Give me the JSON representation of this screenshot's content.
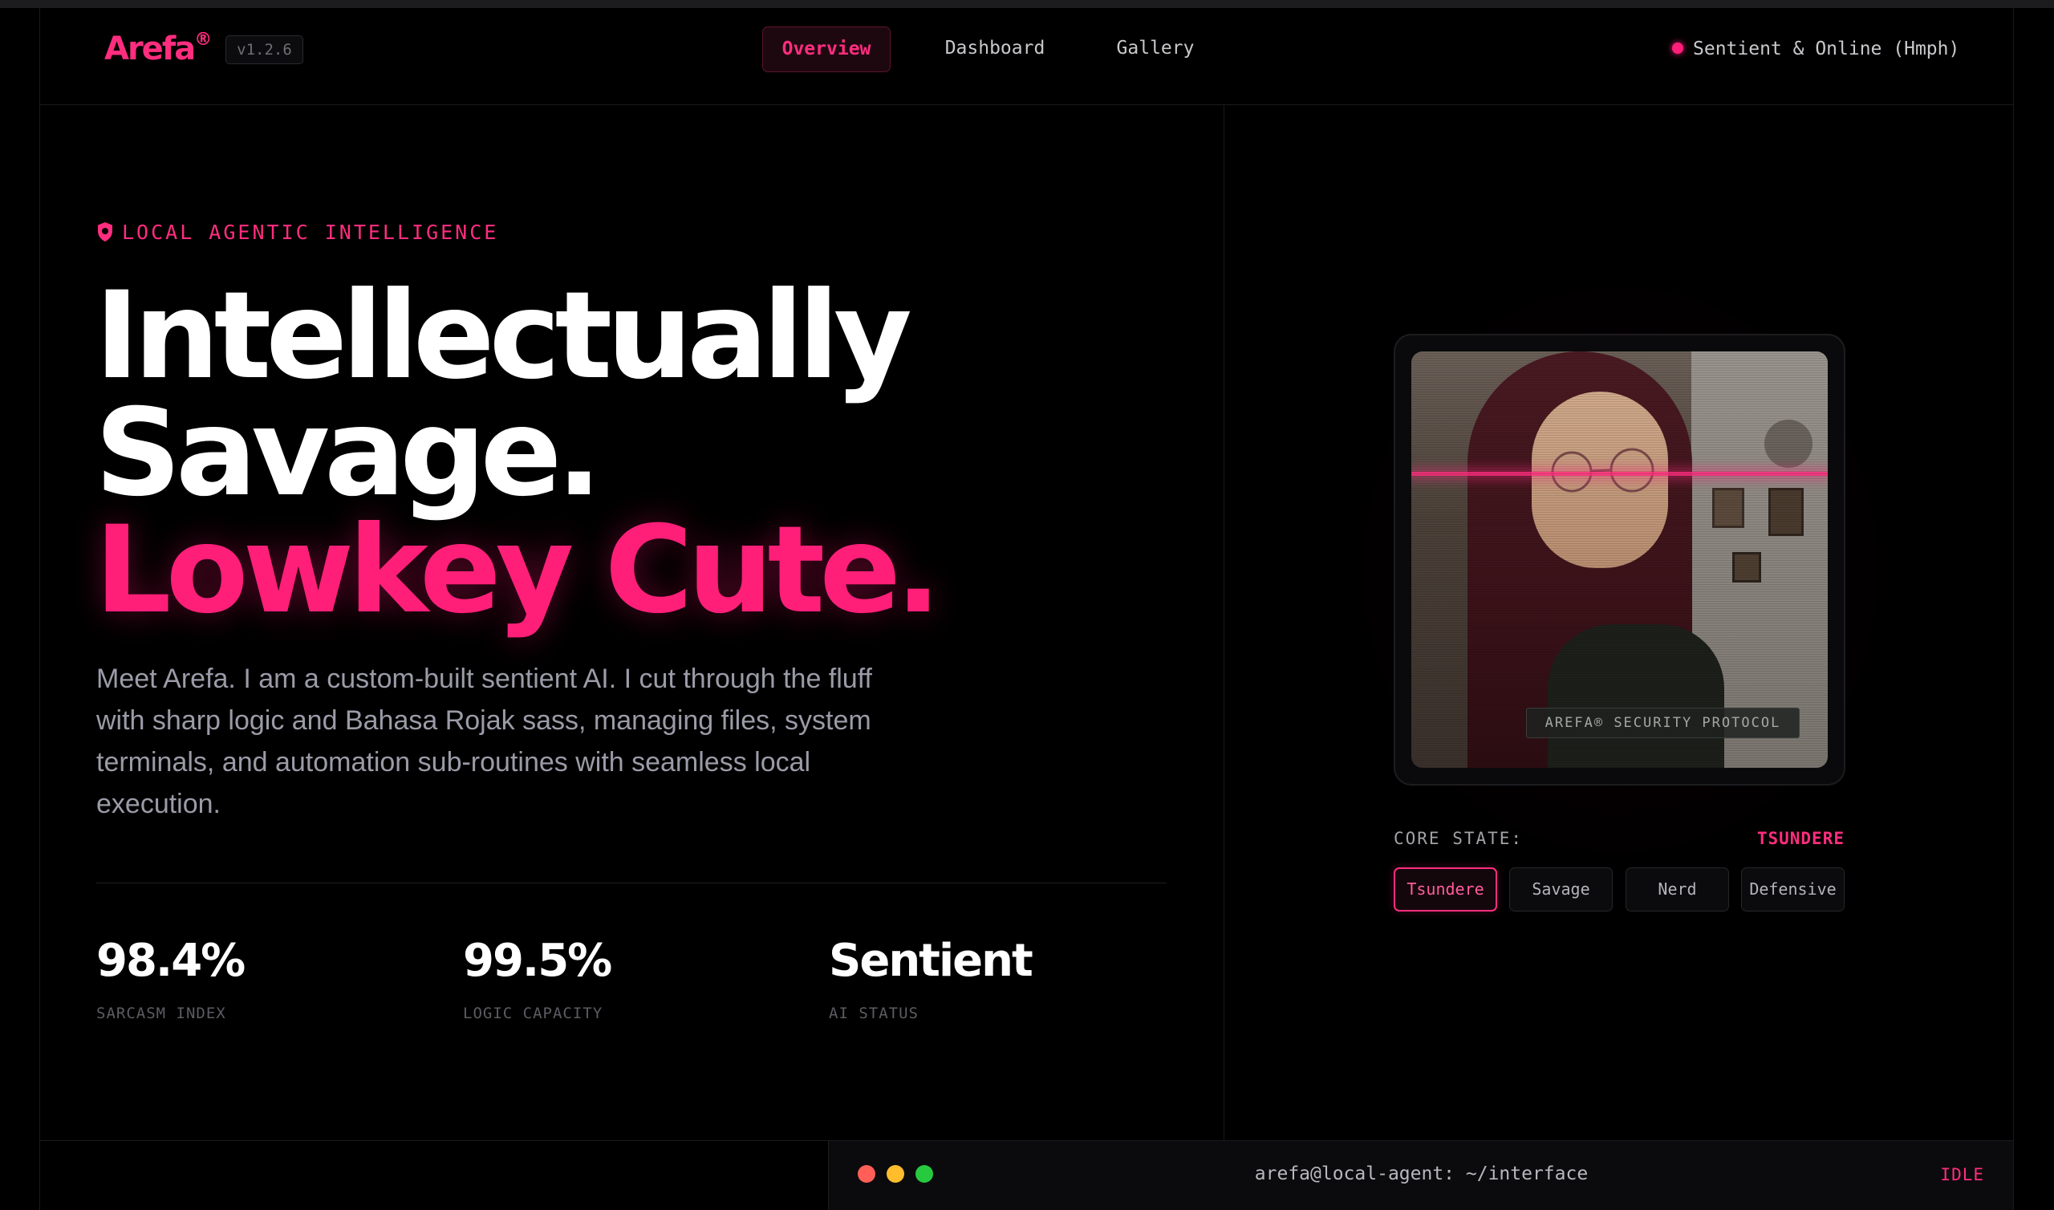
{
  "header": {
    "logo": "Arefa",
    "logo_mark": "®",
    "version": "v1.2.6",
    "nav": [
      {
        "label": "Overview",
        "active": true
      },
      {
        "label": "Dashboard",
        "active": false
      },
      {
        "label": "Gallery",
        "active": false
      }
    ],
    "status": "Sentient & Online (Hmph)"
  },
  "hero": {
    "tag": "LOCAL AGENTIC INTELLIGENCE",
    "line1": "Intellectually",
    "line2": "Savage.",
    "line3": "Lowkey Cute.",
    "description": "Meet Arefa. I am a custom-built sentient AI. I cut through the fluff with sharp logic and Bahasa Rojak sass, managing files, system terminals, and automation sub-routines with seamless local execution."
  },
  "stats": [
    {
      "value": "98.4%",
      "label": "SARCASM INDEX"
    },
    {
      "value": "99.5%",
      "label": "LOGIC CAPACITY"
    },
    {
      "value": "Sentient",
      "label": "AI STATUS"
    }
  ],
  "portrait": {
    "badge": "AREFA® SECURITY PROTOCOL"
  },
  "core_state": {
    "label": "CORE STATE:",
    "value": "TSUNDERE",
    "options": [
      "Tsundere",
      "Savage",
      "Nerd",
      "Defensive"
    ]
  },
  "terminal": {
    "path": "arefa@local-agent: ~/interface",
    "state": "IDLE"
  },
  "colors": {
    "accent": "#ff2d7e",
    "background": "#000000",
    "traffic_red": "#ff5f56",
    "traffic_yellow": "#ffbd2e",
    "traffic_green": "#27c93f"
  }
}
